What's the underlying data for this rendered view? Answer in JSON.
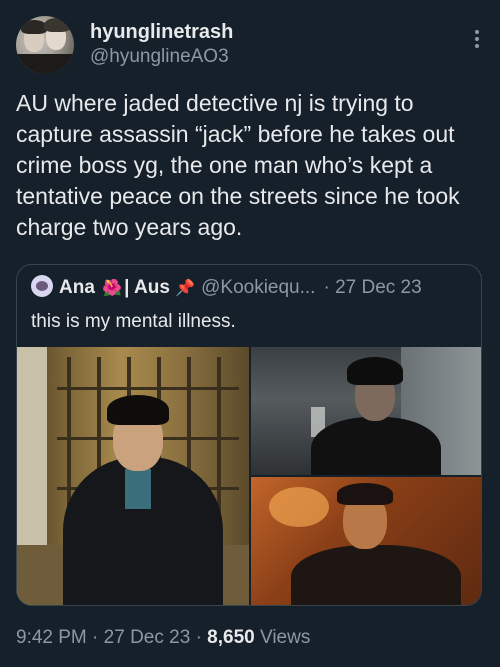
{
  "tweet": {
    "display_name": "hyunglinetrash",
    "handle": "@hyunglineAO3",
    "text": "AU where jaded detective nj is trying to capture assassin “jack” before he takes out crime boss yg, the one man who’s kept a tentative peace on the streets since he took charge two years ago.",
    "time": "9:42 PM",
    "date": "27 Dec 23",
    "views_count": "8,650",
    "views_label": "Views",
    "separator": "·"
  },
  "quote": {
    "name": "Ana",
    "name_emoji": "🌺",
    "name_suffix": "| Aus",
    "pin_emoji": "📌",
    "handle": "@Kookiequ...",
    "date": "· 27 Dec 23",
    "text": "this is my mental illness."
  },
  "colors": {
    "background": "#15202b",
    "text_primary": "#e7e9ea",
    "text_secondary": "#8b98a5",
    "border": "#38444d"
  },
  "icons": [
    "more-options-icon"
  ]
}
